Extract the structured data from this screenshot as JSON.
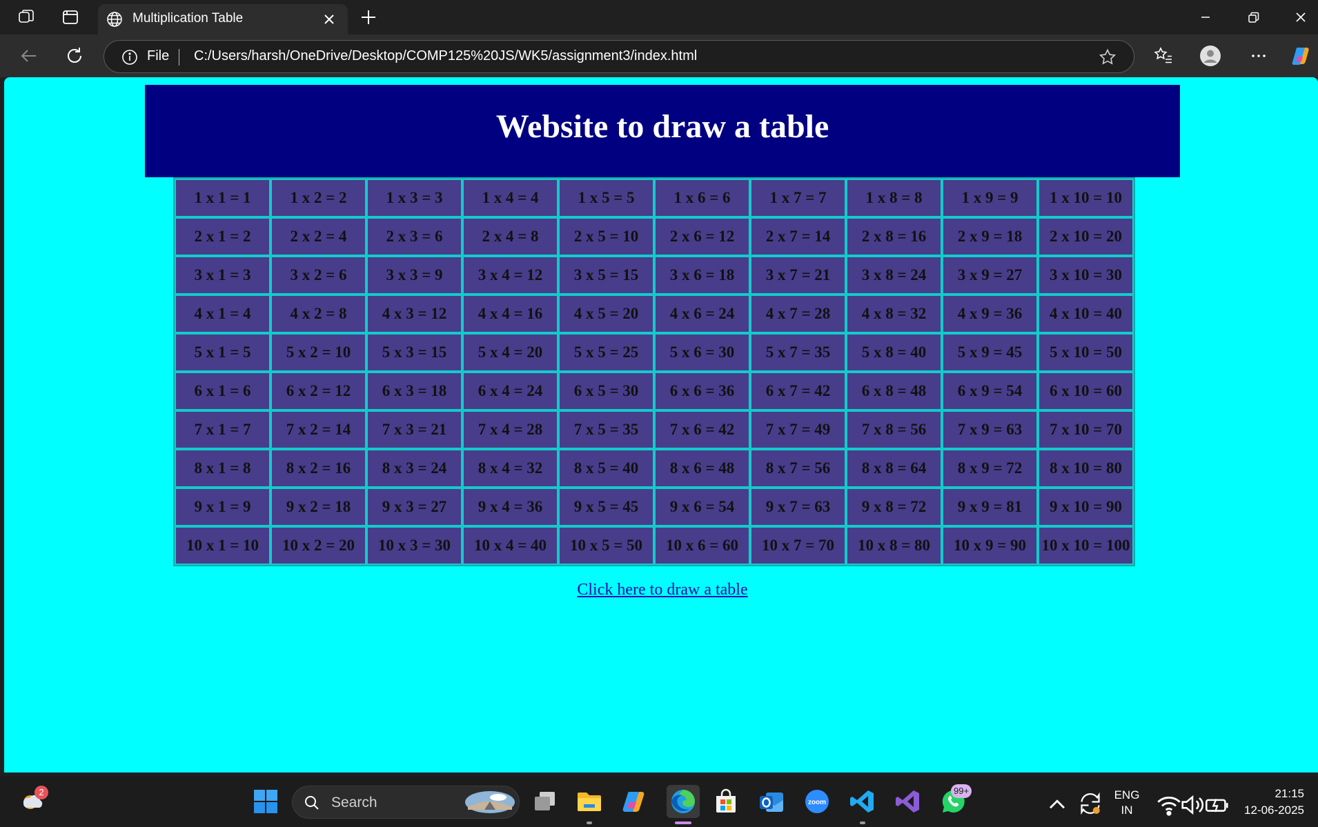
{
  "browser": {
    "tab_title": "Multiplication Table",
    "address_scheme": "File",
    "url": "C:/Users/harsh/OneDrive/Desktop/COMP125%20JS/WK5/assignment3/index.html",
    "icons": [
      "workspaces-icon",
      "tab-actions-icon",
      "globe-icon",
      "close-tab-icon",
      "new-tab-icon",
      "minimize-icon",
      "restore-icon",
      "close-window-icon",
      "back-icon",
      "refresh-icon",
      "info-icon",
      "favorite-star-icon",
      "favorites-icon",
      "profile-icon",
      "more-icon",
      "copilot-icon"
    ]
  },
  "page": {
    "heading": "Website to draw a table",
    "link_text": "Click here to draw a table",
    "colors": {
      "background": "#00ffff",
      "banner": "#000080",
      "cell": "#483d8b",
      "cell_border": "#11cccc",
      "link": "#1a0dab"
    },
    "table": {
      "rows": [
        [
          "1 x 1 = 1",
          "1 x 2 = 2",
          "1 x 3 = 3",
          "1 x 4 = 4",
          "1 x 5 = 5",
          "1 x 6 = 6",
          "1 x 7 = 7",
          "1 x 8 = 8",
          "1 x 9 = 9",
          "1 x 10 = 10"
        ],
        [
          "2 x 1 = 2",
          "2 x 2 = 4",
          "2 x 3 = 6",
          "2 x 4 = 8",
          "2 x 5 = 10",
          "2 x 6 = 12",
          "2 x 7 = 14",
          "2 x 8 = 16",
          "2 x 9 = 18",
          "2 x 10 = 20"
        ],
        [
          "3 x 1 = 3",
          "3 x 2 = 6",
          "3 x 3 = 9",
          "3 x 4 = 12",
          "3 x 5 = 15",
          "3 x 6 = 18",
          "3 x 7 = 21",
          "3 x 8 = 24",
          "3 x 9 = 27",
          "3 x 10 = 30"
        ],
        [
          "4 x 1 = 4",
          "4 x 2 = 8",
          "4 x 3 = 12",
          "4 x 4 = 16",
          "4 x 5 = 20",
          "4 x 6 = 24",
          "4 x 7 = 28",
          "4 x 8 = 32",
          "4 x 9 = 36",
          "4 x 10 = 40"
        ],
        [
          "5 x 1 = 5",
          "5 x 2 = 10",
          "5 x 3 = 15",
          "5 x 4 = 20",
          "5 x 5 = 25",
          "5 x 6 = 30",
          "5 x 7 = 35",
          "5 x 8 = 40",
          "5 x 9 = 45",
          "5 x 10 = 50"
        ],
        [
          "6 x 1 = 6",
          "6 x 2 = 12",
          "6 x 3 = 18",
          "6 x 4 = 24",
          "6 x 5 = 30",
          "6 x 6 = 36",
          "6 x 7 = 42",
          "6 x 8 = 48",
          "6 x 9 = 54",
          "6 x 10 = 60"
        ],
        [
          "7 x 1 = 7",
          "7 x 2 = 14",
          "7 x 3 = 21",
          "7 x 4 = 28",
          "7 x 5 = 35",
          "7 x 6 = 42",
          "7 x 7 = 49",
          "7 x 8 = 56",
          "7 x 9 = 63",
          "7 x 10 = 70"
        ],
        [
          "8 x 1 = 8",
          "8 x 2 = 16",
          "8 x 3 = 24",
          "8 x 4 = 32",
          "8 x 5 = 40",
          "8 x 6 = 48",
          "8 x 7 = 56",
          "8 x 8 = 64",
          "8 x 9 = 72",
          "8 x 10 = 80"
        ],
        [
          "9 x 1 = 9",
          "9 x 2 = 18",
          "9 x 3 = 27",
          "9 x 4 = 36",
          "9 x 5 = 45",
          "9 x 6 = 54",
          "9 x 7 = 63",
          "9 x 8 = 72",
          "9 x 9 = 81",
          "9 x 10 = 90"
        ],
        [
          "10 x 1 = 10",
          "10 x 2 = 20",
          "10 x 3 = 30",
          "10 x 4 = 40",
          "10 x 5 = 50",
          "10 x 6 = 60",
          "10 x 7 = 70",
          "10 x 8 = 80",
          "10 x 9 = 90",
          "10 x 10 = 100"
        ]
      ]
    }
  },
  "taskbar": {
    "weather_badge": "2",
    "search_label": "Search",
    "whatsapp_badge": "99+",
    "language": "ENG",
    "region": "IN",
    "time": "21:15",
    "date": "12-06-2025",
    "icons": [
      "weather-icon",
      "start-icon",
      "search-icon",
      "task-view-icon",
      "file-explorer-icon",
      "copilot-app-icon",
      "edge-icon",
      "microsoft-store-icon",
      "outlook-icon",
      "zoom-icon",
      "vscode-icon",
      "visual-studio-icon",
      "whatsapp-icon",
      "show-hidden-icons-icon",
      "sync-icon",
      "wifi-icon",
      "volume-icon",
      "battery-icon"
    ]
  }
}
